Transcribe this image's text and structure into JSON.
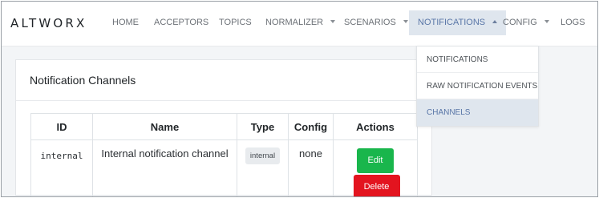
{
  "brand": "ALTWORX",
  "nav": {
    "home": "HOME",
    "acceptors": "ACCEPTORS",
    "topics": "TOPICS",
    "normalizer": "NORMALIZER",
    "scenarios": "SCENARIOS",
    "notifications": "NOTIFICATIONS",
    "config": "CONFIG",
    "logs": "LOGS"
  },
  "dropdown": {
    "items": [
      "NOTIFICATIONS",
      "RAW NOTIFICATION EVENTS",
      "CHANNELS"
    ],
    "selected": "CHANNELS"
  },
  "card": {
    "title": "Notification Channels"
  },
  "table": {
    "headers": [
      "ID",
      "Name",
      "Type",
      "Config",
      "Actions"
    ],
    "rows": [
      {
        "id": "internal",
        "name": "Internal notification channel",
        "type": "internal",
        "config": "none",
        "edit_label": "Edit",
        "delete_label": "Delete"
      }
    ]
  },
  "colors": {
    "active_nav_bg": "#dfe6ee",
    "active_nav_text": "#5a77a8",
    "edit_button": "#19b64c",
    "delete_button": "#e3141f"
  }
}
